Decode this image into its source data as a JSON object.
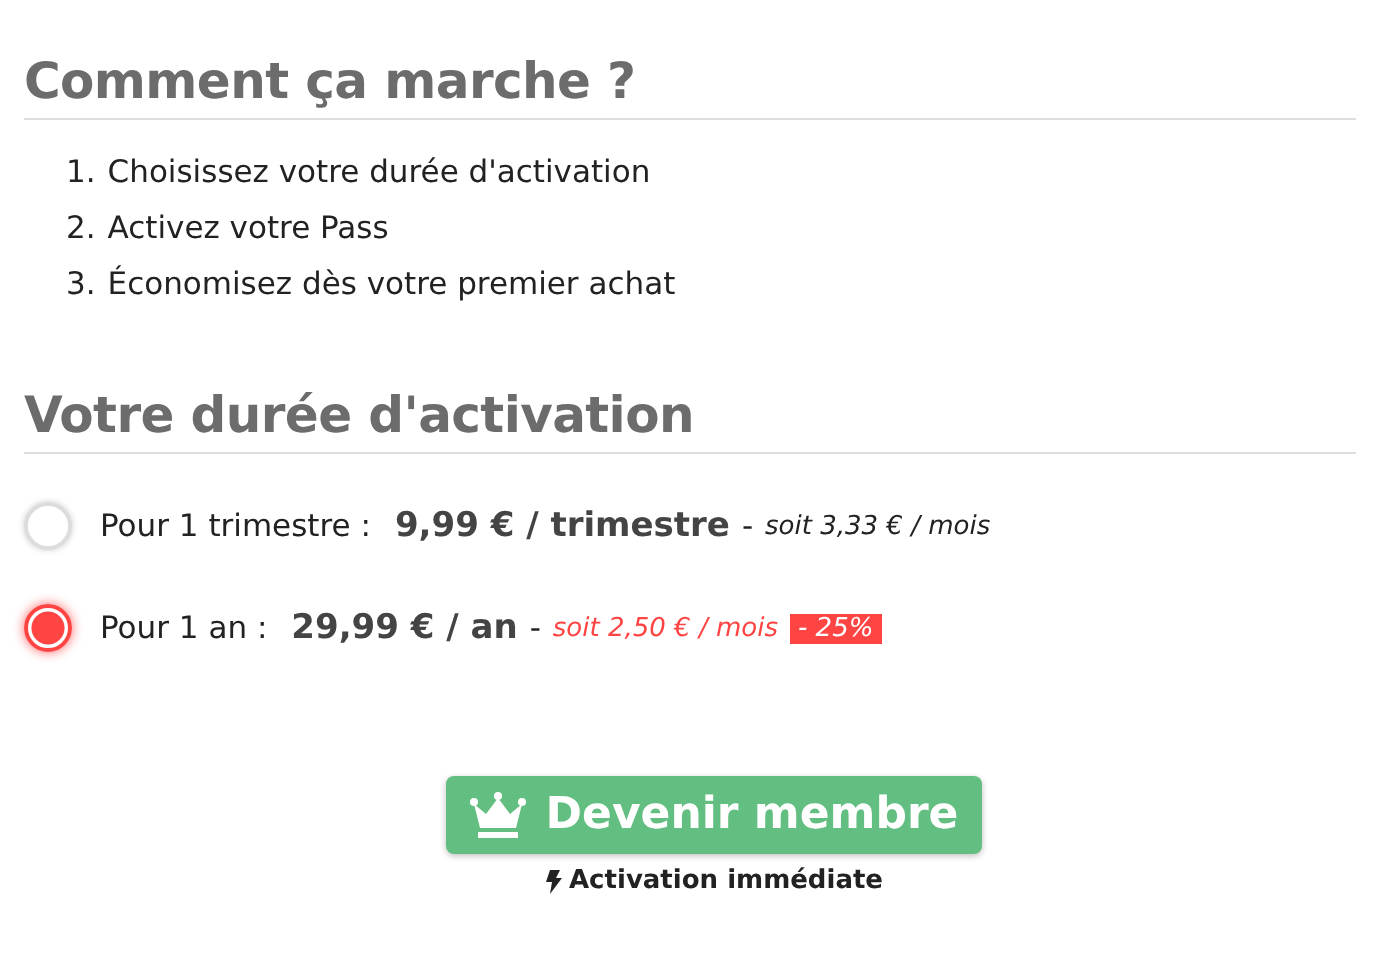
{
  "how_it_works": {
    "title": "Comment ça marche ?",
    "steps": [
      {
        "number": "1.",
        "text": "Choisissez votre durée d'activation"
      },
      {
        "number": "2.",
        "text": "Activez votre Pass"
      },
      {
        "number": "3.",
        "text": "Économisez dès votre premier achat"
      }
    ]
  },
  "duration": {
    "title": "Votre durée d'activation",
    "options": [
      {
        "label": "Pour 1 trimestre :",
        "price": "9,99 € / trimestre",
        "separator": "-",
        "per_month": "soit 3,33 € / mois",
        "selected": false
      },
      {
        "label": "Pour 1 an :",
        "price": "29,99 € / an",
        "separator": "-",
        "per_month": "soit 2,50 € / mois",
        "discount": "- 25%",
        "selected": true
      }
    ]
  },
  "cta": {
    "label": "Devenir membre",
    "note": "Activation immédiate"
  }
}
